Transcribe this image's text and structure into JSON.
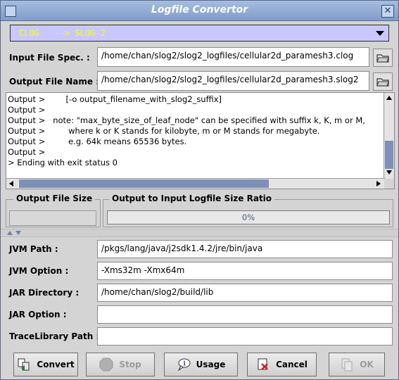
{
  "window": {
    "title": "Logfile Convertor"
  },
  "converter_select": {
    "value": "CLOG   --> SLOG-2"
  },
  "input_file": {
    "label": "Input File Spec. :",
    "value": "/home/chan/slog2/slog2_logfiles/cellular2d_paramesh3.clog"
  },
  "output_file": {
    "label": "Output File Name :",
    "value": "/home/chan/slog2/slog2_logfiles/cellular2d_paramesh3.slog2"
  },
  "output_log": {
    "lines": [
      "Output >        [-o output_filename_with_slog2_suffix]",
      "Output >",
      "Output >   note: \"max_byte_size_of_leaf_node\" can be specified with suffix k, K, m or M,",
      "Output >         where k or K stands for kilobyte, m or M stands for megabyte.",
      "Output >         e.g. 64k means 65536 bytes.",
      "Output >",
      "> Ending with exit status 0"
    ]
  },
  "output_file_size": {
    "label": "Output File Size",
    "value": ""
  },
  "ratio": {
    "label": "Output to Input Logfile Size Ratio",
    "percent_text": "0%",
    "fraction": 0
  },
  "jvm_path": {
    "label": "JVM Path :",
    "value": "/pkgs/lang/java/j2sdk1.4.2/jre/bin/java"
  },
  "jvm_option": {
    "label": "JVM Option :",
    "value": "-Xms32m -Xmx64m"
  },
  "jar_directory": {
    "label": "JAR Directory :",
    "value": "/home/chan/slog2/build/lib"
  },
  "jar_option": {
    "label": "JAR Option :",
    "value": ""
  },
  "trace_library_path": {
    "label": "TraceLibrary Path :",
    "value": ""
  },
  "buttons": {
    "convert": "Convert",
    "stop": "Stop",
    "usage": "Usage",
    "cancel": "Cancel",
    "ok": "OK"
  },
  "colors": {
    "titlebar": "#7f9cc8",
    "combo_bg": "#c8c8ff",
    "combo_text": "#ffff00",
    "scroll_thumb": "#7f90b8"
  },
  "icons": [
    "folder-icon",
    "convert-icon",
    "stop-icon",
    "usage-icon",
    "cancel-icon",
    "ok-icon",
    "close-icon"
  ]
}
